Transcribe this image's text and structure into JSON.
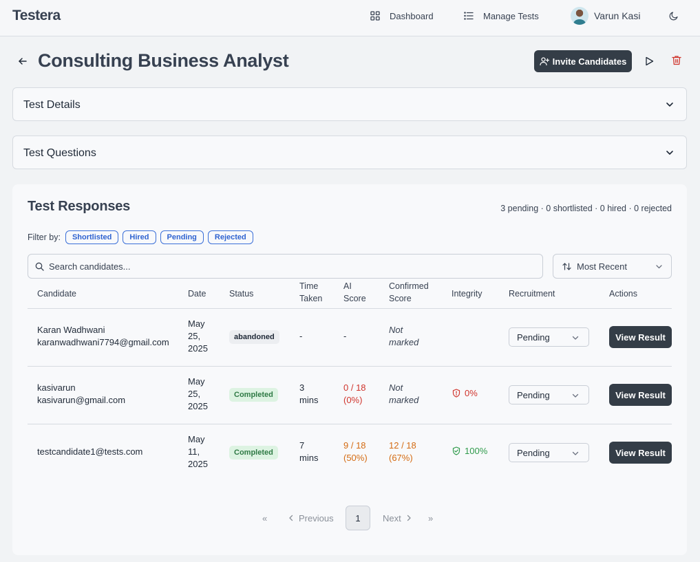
{
  "app": {
    "brand": "Testera"
  },
  "nav": {
    "dashboard": "Dashboard",
    "manage_tests": "Manage Tests",
    "user_name": "Varun Kasi"
  },
  "page": {
    "title": "Consulting Business Analyst",
    "invite_label": "Invite Candidates"
  },
  "sections": {
    "details": "Test Details",
    "questions": "Test Questions"
  },
  "responses": {
    "title": "Test Responses",
    "summary": "3 pending · 0 shortlisted · 0 hired · 0 rejected",
    "filter_label": "Filter by:",
    "filters": [
      "Shortlisted",
      "Hired",
      "Pending",
      "Rejected"
    ],
    "search_placeholder": "Search candidates...",
    "sort_value": "Most Recent",
    "headers": {
      "candidate": "Candidate",
      "date": "Date",
      "status": "Status",
      "time_taken_1": "Time",
      "time_taken_2": "Taken",
      "ai_score_1": "AI",
      "ai_score_2": "Score",
      "confirmed_1": "Confirmed",
      "confirmed_2": "Score",
      "integrity": "Integrity",
      "recruitment": "Recruitment",
      "actions": "Actions"
    },
    "rows": [
      {
        "name": "Karan Wadhwani",
        "email": "karanwadhwani7794@gmail.com",
        "date_1": "May",
        "date_2": "25,",
        "date_3": "2025",
        "status": "abandoned",
        "time_1": "-",
        "time_2": "",
        "ai_1": "-",
        "ai_2": "",
        "confirmed_1": "Not",
        "confirmed_2": "marked",
        "integrity": "",
        "recruitment": "Pending",
        "action": "View Result"
      },
      {
        "name": "kasivarun",
        "email": "kasivarun@gmail.com",
        "date_1": "May",
        "date_2": "25,",
        "date_3": "2025",
        "status": "Completed",
        "time_1": "3",
        "time_2": "mins",
        "ai_1": "0 / 18",
        "ai_2": "(0%)",
        "confirmed_1": "Not",
        "confirmed_2": "marked",
        "integrity": "0%",
        "recruitment": "Pending",
        "action": "View Result"
      },
      {
        "name": "",
        "email": "testcandidate1@tests.com",
        "date_1": "May",
        "date_2": "11,",
        "date_3": "2025",
        "status": "Completed",
        "time_1": "7",
        "time_2": "mins",
        "ai_1": "9 / 18",
        "ai_2": "(50%)",
        "confirmed_1": "12 / 18",
        "confirmed_2": "(67%)",
        "integrity": "100%",
        "recruitment": "Pending",
        "action": "View Result"
      }
    ],
    "pagination": {
      "first": "«",
      "previous": "Previous",
      "page": "1",
      "next": "Next",
      "last": "»"
    }
  },
  "colors": {
    "primary_dark": "#343d47",
    "danger": "#d0342c",
    "warning": "#d46b12",
    "success": "#2e9a4a",
    "chip_blue": "#2f63d0"
  }
}
